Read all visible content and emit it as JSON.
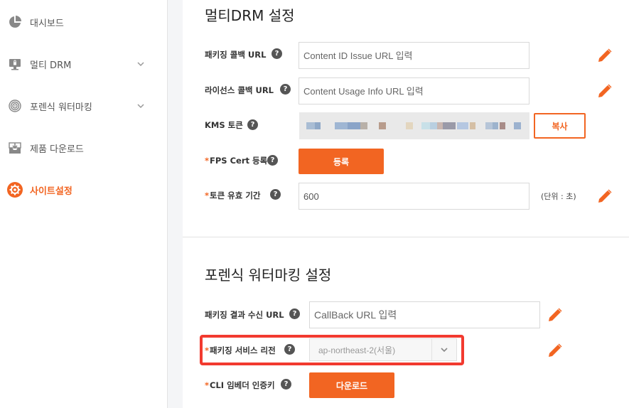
{
  "colors": {
    "accent": "#f26522",
    "highlight": "#f23a2f"
  },
  "sidebar": {
    "items": [
      {
        "label": "대시보드",
        "icon": "pie-chart-icon",
        "has_chevron": false,
        "active": false
      },
      {
        "label": "멀티 DRM",
        "icon": "monitor-lock-icon",
        "has_chevron": true,
        "active": false
      },
      {
        "label": "포렌식 워터마킹",
        "icon": "fingerprint-icon",
        "has_chevron": true,
        "active": false
      },
      {
        "label": "제품 다운로드",
        "icon": "download-box-icon",
        "has_chevron": false,
        "active": false
      },
      {
        "label": "사이트설정",
        "icon": "gear-icon",
        "has_chevron": false,
        "active": true
      }
    ]
  },
  "drm_section": {
    "title": "멀티DRM 설정",
    "packaging_callback": {
      "label": "패키징 콜백 URL",
      "placeholder": "Content ID Issue URL 입력"
    },
    "license_callback": {
      "label": "라이선스 콜백 URL",
      "placeholder": "Content Usage Info URL 입력"
    },
    "kms_token": {
      "label": "KMS 토큰",
      "copy_label": "복사"
    },
    "fps_cert": {
      "required": "*",
      "label": "FPS Cert 등록",
      "button": "등록"
    },
    "token_validity": {
      "required": "*",
      "label": "토큰 유효 기간",
      "value": "600",
      "unit": "(단위 : 초)"
    }
  },
  "watermark_section": {
    "title": "포렌식 워터마킹 설정",
    "packaging_result": {
      "label": "패키징 결과 수신 URL",
      "placeholder": "CallBack URL 입력"
    },
    "service_region": {
      "required": "*",
      "label": "패키징 서비스 리전",
      "selected": "ap-northeast-2(서울)"
    },
    "cli_embedder": {
      "required": "*",
      "label": "CLI 임베더 인증키",
      "button": "다운로드"
    }
  },
  "help_glyph": "?"
}
